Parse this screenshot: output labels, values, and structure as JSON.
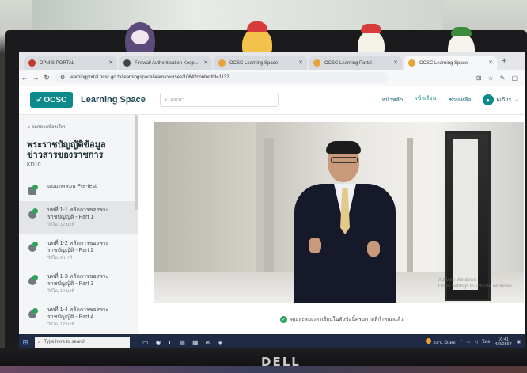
{
  "browser": {
    "tabs": [
      {
        "label": "DPMIS PORTAL",
        "favicon_color": "#c0392b",
        "active": false
      },
      {
        "label": "Firewall Authentication Keep...",
        "favicon_color": "#444444",
        "active": false
      },
      {
        "label": "OCSC Learning Space",
        "favicon_color": "#e8a23a",
        "active": false
      },
      {
        "label": "OCSC Learning Portal",
        "favicon_color": "#e8a23a",
        "active": false
      },
      {
        "label": "OCSC Learning Space",
        "favicon_color": "#e8a23a",
        "active": true
      }
    ],
    "url": "learningportal.ocsc.go.th/learningspace/learn/courses/1064?contentId=1132"
  },
  "site": {
    "logo_text": "OCSC",
    "title": "Learning Space",
    "search_placeholder": "ค้นหา",
    "nav": [
      {
        "label": "หน้าหลัก",
        "active": false
      },
      {
        "label": "เข้าเรียน",
        "active": true
      },
      {
        "label": "ช่วยเหลือ",
        "active": false
      }
    ],
    "user_name": "ผเกียร"
  },
  "sidebar": {
    "back_label": "ออกจากห้องเรียน",
    "course_title_line1": "พระราชบัญญัติข้อมูล",
    "course_title_line2": "ข่าวสารของราชการ",
    "course_code": "KD10",
    "items": [
      {
        "title": "แบบทดสอบ Pre-test",
        "title2": "",
        "meta": "",
        "type": "doc"
      },
      {
        "title": "บทที่ 1-1 หลักการของพระ",
        "title2": "ราชบัญญัติ - Part 1",
        "meta": "วิดีโอ, 12 นาที",
        "type": "video",
        "selected": true
      },
      {
        "title": "บทที่ 1-2 หลักการของพระ",
        "title2": "ราชบัญญัติ - Part 2",
        "meta": "วิดีโอ, 6 นาที",
        "type": "video"
      },
      {
        "title": "บทที่ 1-3 หลักการของพระ",
        "title2": "ราชบัญญัติ - Part 3",
        "meta": "วิดีโอ, 10 นาที",
        "type": "video"
      },
      {
        "title": "บทที่ 1-4 หลักการของพระ",
        "title2": "ราชบัญญัติ - Part 4",
        "meta": "วิดีโอ, 12 นาที",
        "type": "video"
      }
    ]
  },
  "video": {
    "watermark_line1": "Activate Windows",
    "watermark_line2": "Go to Settings to activate Windows."
  },
  "completion_text": "คุณสะสมเวลาเรียนในหัวข้อนี้ครบตามที่กำหนดแล้ว",
  "taskbar": {
    "search_placeholder": "Type here to search",
    "weather": "31°C มีแดด",
    "language": "ไทย",
    "time": "16:41",
    "date": "4/2/2567"
  },
  "monitor_brand": "DELL"
}
